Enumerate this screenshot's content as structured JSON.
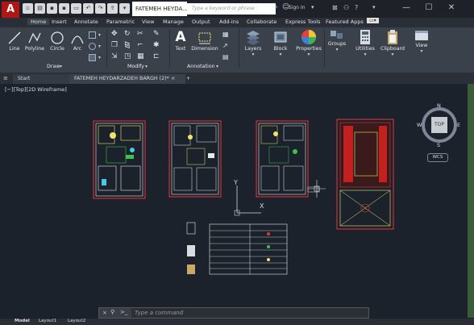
{
  "app": {
    "logo": "A",
    "title": "FATEMEH HEYDA...",
    "search_placeholder": "Type a keyword or phrase",
    "sign_in": "Sign In"
  },
  "ribbon_tabs": [
    "Home",
    "Insert",
    "Annotate",
    "Parametric",
    "View",
    "Manage",
    "Output",
    "Add-ins",
    "Collaborate",
    "Express Tools",
    "Featured Apps"
  ],
  "ribbon": {
    "draw": {
      "panel_label": "Draw",
      "line": "Line",
      "polyline": "Polyline",
      "circle": "Circle",
      "arc": "Arc"
    },
    "modify": {
      "panel_label": "Modify"
    },
    "annotation": {
      "panel_label": "Annotation",
      "text": "Text",
      "dimension": "Dimension"
    },
    "layers": "Layers",
    "block": "Block",
    "properties": "Properties",
    "groups": "Groups",
    "utilities": "Utilities",
    "clipboard": "Clipboard",
    "view": "View"
  },
  "file_tabs": {
    "start": "Start",
    "document": "FATEMEH HEYDARZADEH BARGH (2)*",
    "close": "×",
    "new": "+"
  },
  "viewport": {
    "label": "[−][Top][2D Wireframe]",
    "viewcube": {
      "n": "N",
      "s": "S",
      "e": "E",
      "w": "W",
      "top": "TOP",
      "wcs": "WCS"
    },
    "ucs": {
      "x": "X",
      "y": "Y"
    }
  },
  "command_line": {
    "placeholder": "Type a command",
    "close": "×"
  },
  "status_bar": {
    "model_tab": "Model",
    "layout1": "Layout1",
    "layout2": "Layout2"
  },
  "colors": {
    "accent_red": "#b31515",
    "viewport_bg": "#1b222c",
    "ribbon_bg": "#3b414b"
  }
}
